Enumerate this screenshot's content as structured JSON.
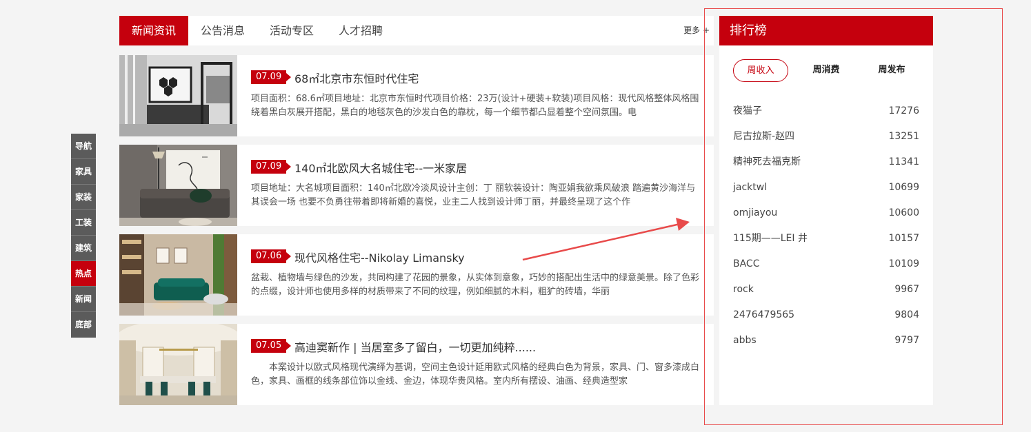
{
  "side_nav": [
    "导航",
    "家具",
    "家装",
    "工装",
    "建筑",
    "热点",
    "新闻",
    "底部"
  ],
  "side_nav_active": 5,
  "news": {
    "tabs": [
      "新闻资讯",
      "公告消息",
      "活动专区",
      "人才招聘"
    ],
    "more": "更多 +",
    "items": [
      {
        "date": "07.09",
        "title": "68㎡北京市东恒时代住宅",
        "desc": "项目面积：68.6㎡项目地址：北京市东恒时代项目价格：23万(设计+硬装+软装)项目风格：现代风格整体风格围绕着黑白灰展开搭配，黑白的地毯灰色的沙发白色的靠枕，每一个细节都凸显着整个空间氛围。电"
      },
      {
        "date": "07.09",
        "title": "140㎡北欧风大名城住宅--一米家居",
        "desc": "项目地址：大名城项目面积：140㎡北欧冷淡风设计主创：丁 丽软装设计：陶亚娟我欲乘风破浪 踏遍黄沙海洋与其误会一场 也要不负勇往带着即将新婚的喜悦，业主二人找到设计师丁丽，并最终呈现了这个作"
      },
      {
        "date": "07.06",
        "title": "现代风格住宅--Nikolay Limansky",
        "desc": "盆栽、植物墙与绿色的沙发，共同构建了花园的景象，从实体到意象，巧妙的搭配出生活中的绿意美景。除了色彩的点缀，设计师也使用多样的材质带来了不同的纹理，例如细腻的木料，粗犷的砖墙，华丽"
      },
      {
        "date": "07.05",
        "title": "高迪窦新作 | 当居室多了留白，一切更加纯粹......",
        "desc": "　　本案设计以欧式风格现代演绎为基调，空间主色设计延用欧式风格的经典白色为背景，家具、门、窗多漆成白色，家具、画框的线条部位饰以金线、金边，体现华贵风格。室内所有摆设、油画、经典造型家"
      }
    ]
  },
  "ranking": {
    "title": "排行榜",
    "tabs": [
      "周收入",
      "周消费",
      "周发布"
    ],
    "rows": [
      {
        "name": "夜猫子",
        "value": "17276"
      },
      {
        "name": "尼古拉斯-赵四",
        "value": "13251"
      },
      {
        "name": "精神死去福克斯",
        "value": "11341"
      },
      {
        "name": "jacktwl",
        "value": "10699"
      },
      {
        "name": "omjiayou",
        "value": "10600"
      },
      {
        "name": "115期——LEI 井",
        "value": "10157"
      },
      {
        "name": "BACC",
        "value": "10109"
      },
      {
        "name": "rock",
        "value": "9967"
      },
      {
        "name": "2476479565",
        "value": "9804"
      },
      {
        "name": "abbs",
        "value": "9797"
      }
    ]
  },
  "colors": {
    "accent": "#c5000d",
    "side_nav_bg": "#5b5b5b",
    "annotation": "#e84a4a"
  }
}
